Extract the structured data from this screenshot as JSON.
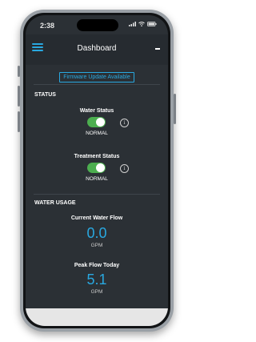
{
  "status_bar": {
    "time": "2:38"
  },
  "header": {
    "title": "Dashboard"
  },
  "firmware_button": "Firmware Update Available",
  "status_section": {
    "title": "STATUS",
    "water_status": {
      "label": "Water Status",
      "state": "NORMAL",
      "enabled": true
    },
    "treatment_status": {
      "label": "Treatment Status",
      "state": "NORMAL",
      "enabled": true
    }
  },
  "water_usage_section": {
    "title": "WATER USAGE",
    "current_flow": {
      "label": "Current Water Flow",
      "value": "0.0",
      "unit": "GPM"
    },
    "peak_flow": {
      "label": "Peak Flow Today",
      "value": "5.1",
      "unit": "GPM"
    }
  },
  "colors": {
    "accent": "#29a8e0",
    "toggle_on": "#4cae4f",
    "background": "#2b3035"
  },
  "icons": [
    "menu-icon",
    "info-icon",
    "signal-icon",
    "wifi-icon",
    "battery-icon"
  ]
}
